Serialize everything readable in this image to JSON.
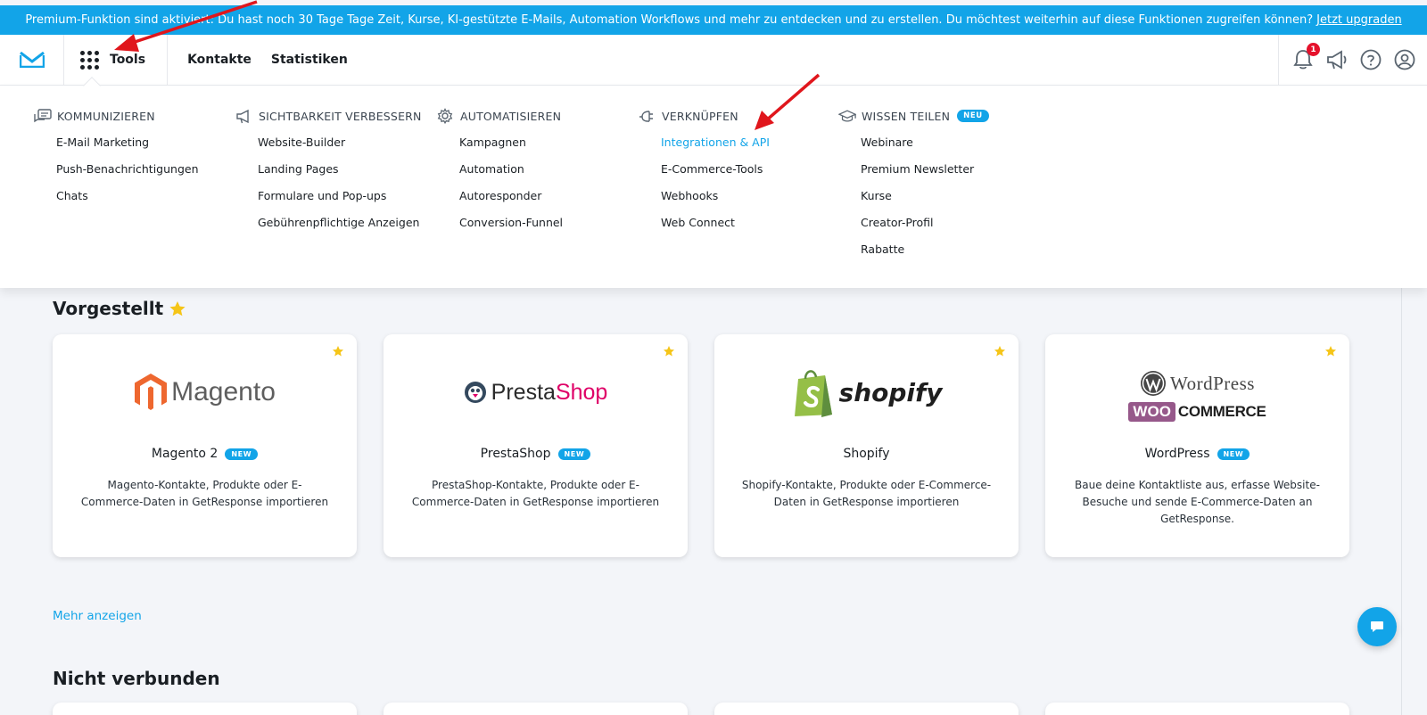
{
  "banner": {
    "text": "Premium-Funktion sind aktiviert: Du hast noch 30 Tage Tage Zeit, Kurse, KI-gestützte E-Mails, Automation Workflows und mehr zu entdecken und zu erstellen. Du möchtest weiterhin auf diese Funktionen zugreifen können?",
    "link": "Jetzt upgraden"
  },
  "topbar": {
    "tools_label": "Tools",
    "nav": [
      "Kontakte",
      "Statistiken"
    ],
    "notification_count": "1"
  },
  "mega_menu": {
    "columns": [
      {
        "title": "KOMMUNIZIEREN",
        "icon": "chat-bubbles-icon",
        "items": [
          "E-Mail Marketing",
          "Push-Benachrichtigungen",
          "Chats"
        ]
      },
      {
        "title": "SICHTBARKEIT VERBESSERN",
        "icon": "megaphone-icon",
        "items": [
          "Website-Builder",
          "Landing Pages",
          "Formulare und Pop-ups",
          "Gebührenpflichtige Anzeigen"
        ]
      },
      {
        "title": "AUTOMATISIEREN",
        "icon": "gear-icon",
        "items": [
          "Kampagnen",
          "Automation",
          "Autoresponder",
          "Conversion-Funnel"
        ]
      },
      {
        "title": "VERKNÜPFEN",
        "icon": "plug-icon",
        "items": [
          "Integrationen & API",
          "E-Commerce-Tools",
          "Webhooks",
          "Web Connect"
        ],
        "active": "Integrationen & API"
      },
      {
        "title": "WISSEN TEILEN",
        "icon": "graduation-cap-icon",
        "badge": "NEU",
        "items": [
          "Webinare",
          "Premium Newsletter",
          "Kurse",
          "Creator-Profil",
          "Rabatte"
        ]
      }
    ]
  },
  "featured": {
    "title": "Vorgestellt",
    "cards": [
      {
        "name": "Magento 2",
        "badge": "NEW",
        "logo_text": "Magento",
        "desc": "Magento-Kontakte, Produkte oder E-Commerce-Daten in GetResponse importieren"
      },
      {
        "name": "PrestaShop",
        "badge": "NEW",
        "logo_text_a": "Presta",
        "logo_text_b": "Shop",
        "desc": "PrestaShop-Kontakte, Produkte oder E-Commerce-Daten in GetResponse importieren"
      },
      {
        "name": "Shopify",
        "badge": "",
        "logo_text": "shopify",
        "desc": "Shopify-Kontakte, Produkte oder E-Commerce-Daten in GetResponse importieren"
      },
      {
        "name": "WordPress",
        "badge": "NEW",
        "logo_text_a": "WordPress",
        "logo_text_b": "WOO",
        "logo_text_c": "COMMERCE",
        "desc": "Baue deine Kontaktliste aus, erfasse Website-Besuche und sende E-Commerce-Daten an GetResponse."
      }
    ],
    "more_link": "Mehr anzeigen"
  },
  "not_connected": {
    "title": "Nicht verbunden"
  },
  "colors": {
    "accent": "#12a4e8",
    "notification": "#e5112b",
    "star": "#f5c518"
  }
}
